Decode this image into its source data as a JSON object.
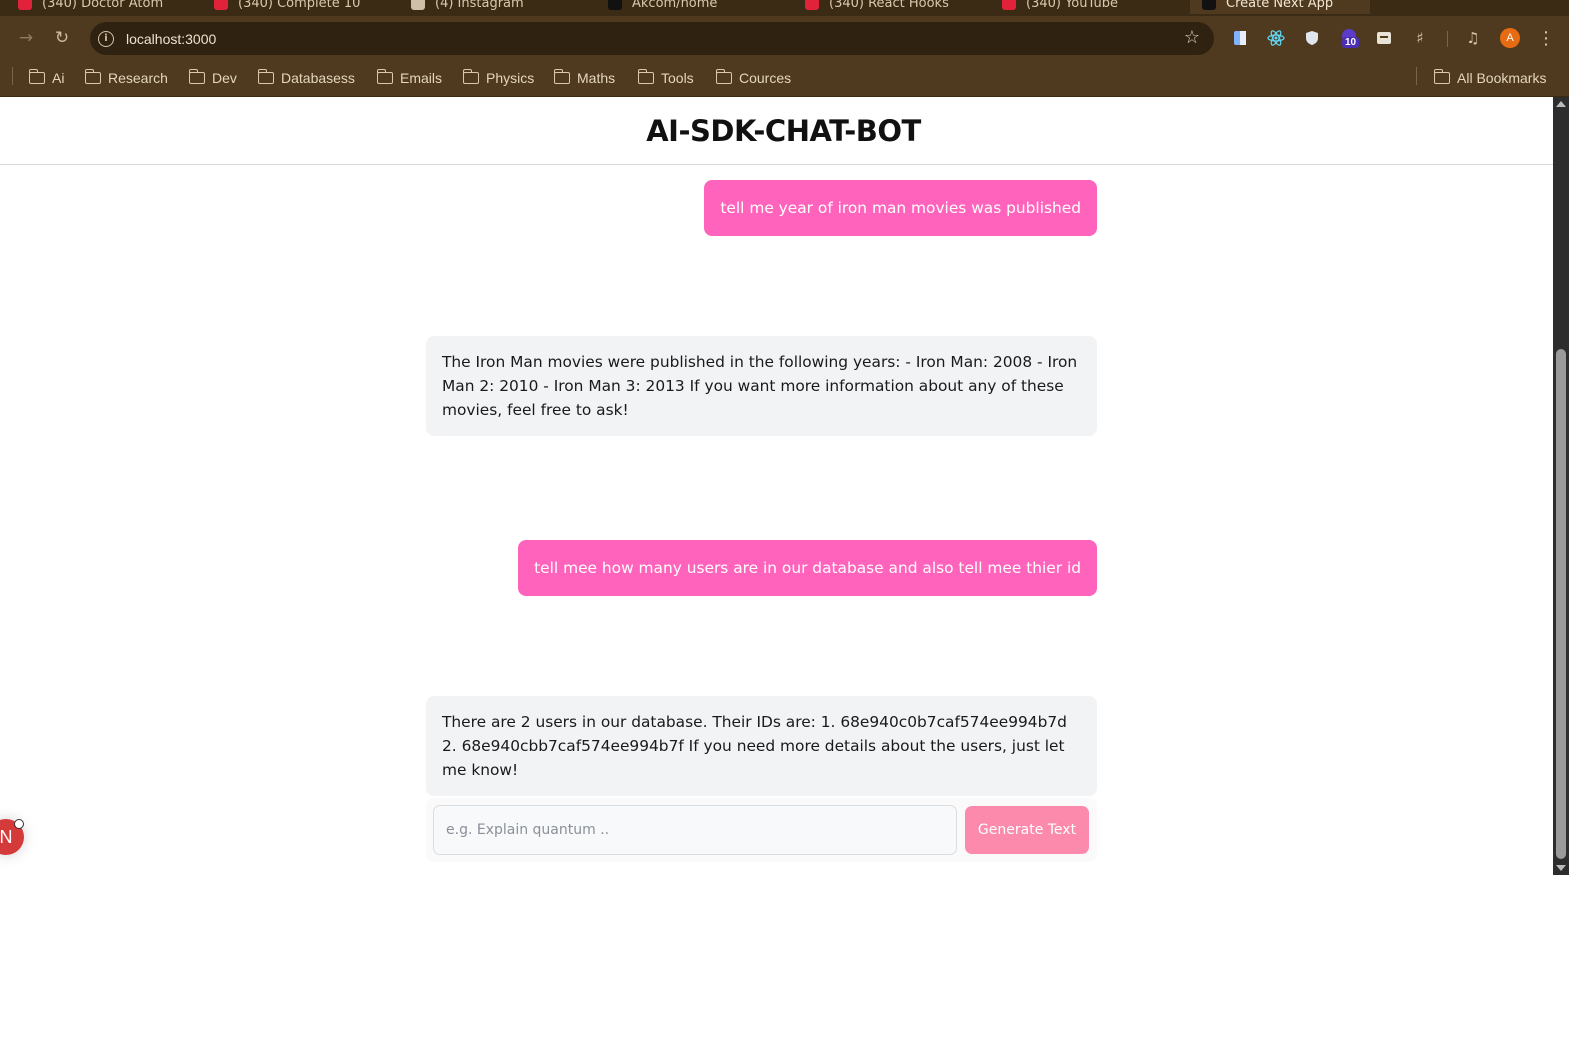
{
  "browser": {
    "url": "localhost:3000",
    "tabs": [
      {
        "title": "(340) Doctor Atom"
      },
      {
        "title": "(340) Complete 10"
      },
      {
        "title": "(4) Instagram"
      },
      {
        "title": "Akcom/home"
      },
      {
        "title": "(340) React Hooks"
      },
      {
        "title": "(340) YouTube"
      },
      {
        "title": "Create Next App"
      }
    ],
    "extension_badge": "10",
    "avatar_letter": "A",
    "bookmarks": [
      "Ai",
      "Research",
      "Dev",
      "Databasess",
      "Emails",
      "Physics",
      "Maths",
      "Tools",
      "Cources"
    ],
    "all_bookmarks": "All Bookmarks"
  },
  "page": {
    "title": "AI-SDK-CHAT-BOT",
    "messages": [
      {
        "role": "user",
        "text": "tell me year of iron man movies was published"
      },
      {
        "role": "assistant",
        "text": "The Iron Man movies were published in the following years: - Iron Man: 2008 - Iron Man 2: 2010 - Iron Man 3: 2013 If you want more information about any of these movies, feel free to ask!"
      },
      {
        "role": "user",
        "text": "tell mee how many users are in our database and also tell mee thier id"
      },
      {
        "role": "assistant",
        "text": "There are 2 users in our database. Their IDs are: 1. 68e940c0b7caf574ee994b7d 2. 68e940cbb7caf574ee994b7f If you need more details about the users, just let me know!"
      }
    ],
    "input": {
      "value": "",
      "placeholder": "e.g. Explain quantum .."
    },
    "submit_label": "Generate Text",
    "dev_badge_letter": "N"
  },
  "colors": {
    "user_bubble": "#ff63bb",
    "assistant_bubble": "#f2f3f5",
    "generate_button": "#fb8aac",
    "browser_chrome": "#4f3a1f"
  }
}
